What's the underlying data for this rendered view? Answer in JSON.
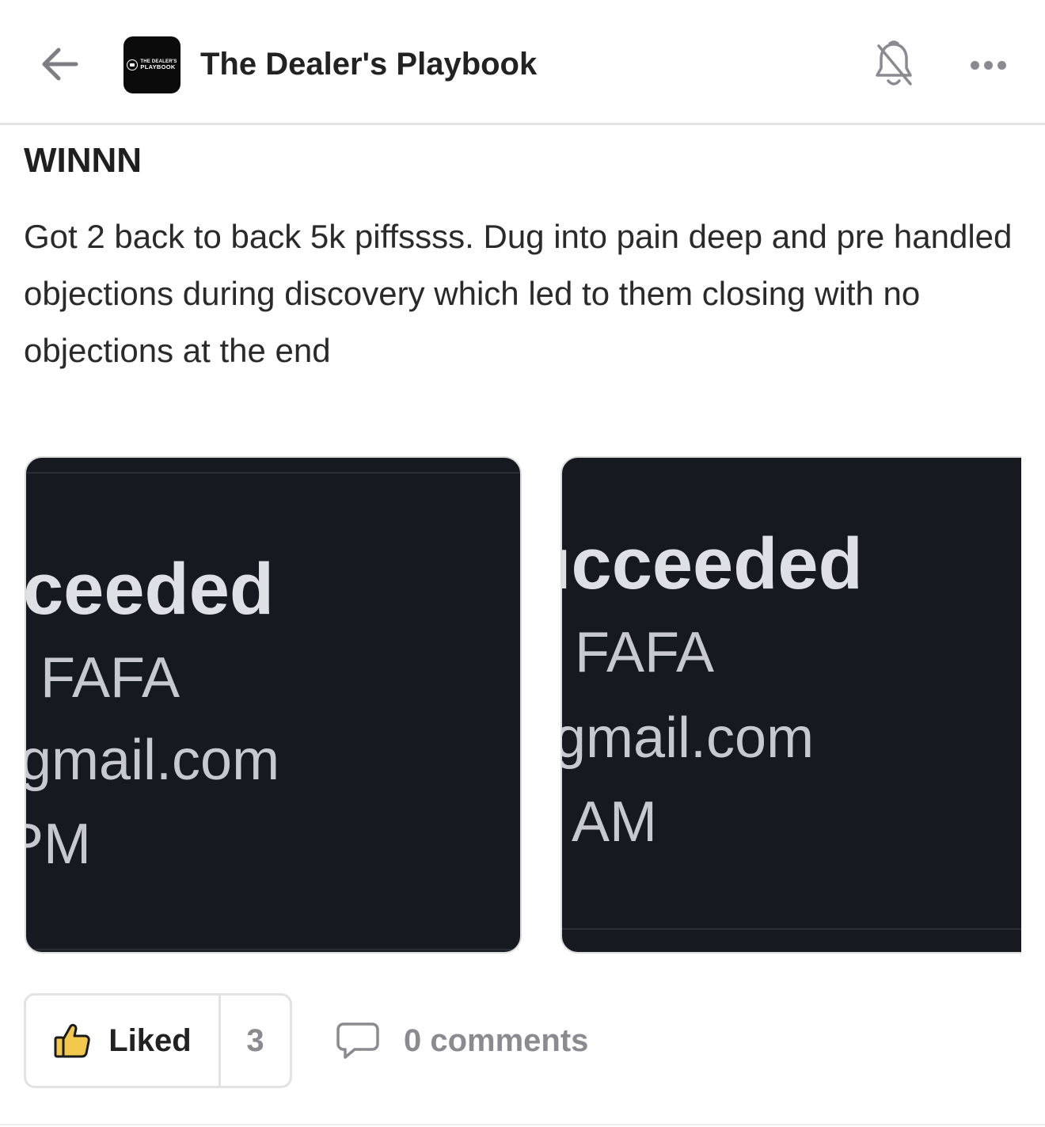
{
  "header": {
    "back_icon": "arrow-left-icon",
    "logo": {
      "line1": "THE DEALER'S",
      "line2": "PLAYBOOK"
    },
    "title": "The Dealer's Playbook",
    "notification_icon": "bell-off-icon",
    "more_icon": "more-horizontal-icon"
  },
  "post": {
    "title": "WINNN",
    "body": "Got 2 back to back 5k piffssss. Dug into pain deep and pre handled objections during discovery which led to them closing with no objections at the end"
  },
  "images": [
    {
      "line1": "ceeded",
      "line2": "FAFA",
      "line3": "gmail.com",
      "line4": "PM"
    },
    {
      "line1": "ıcceeded",
      "line2": "FAFA",
      "line3": "gmail.com",
      "line4": "AM"
    }
  ],
  "actions": {
    "like_icon": "thumbs-up-icon",
    "like_label": "Liked",
    "like_count": "3",
    "comment_icon": "comment-icon",
    "comments_label": "0 comments"
  },
  "colors": {
    "like_icon_fill": "#f2c94c",
    "image_bg": "#171920",
    "muted_text": "#8a8a90"
  }
}
